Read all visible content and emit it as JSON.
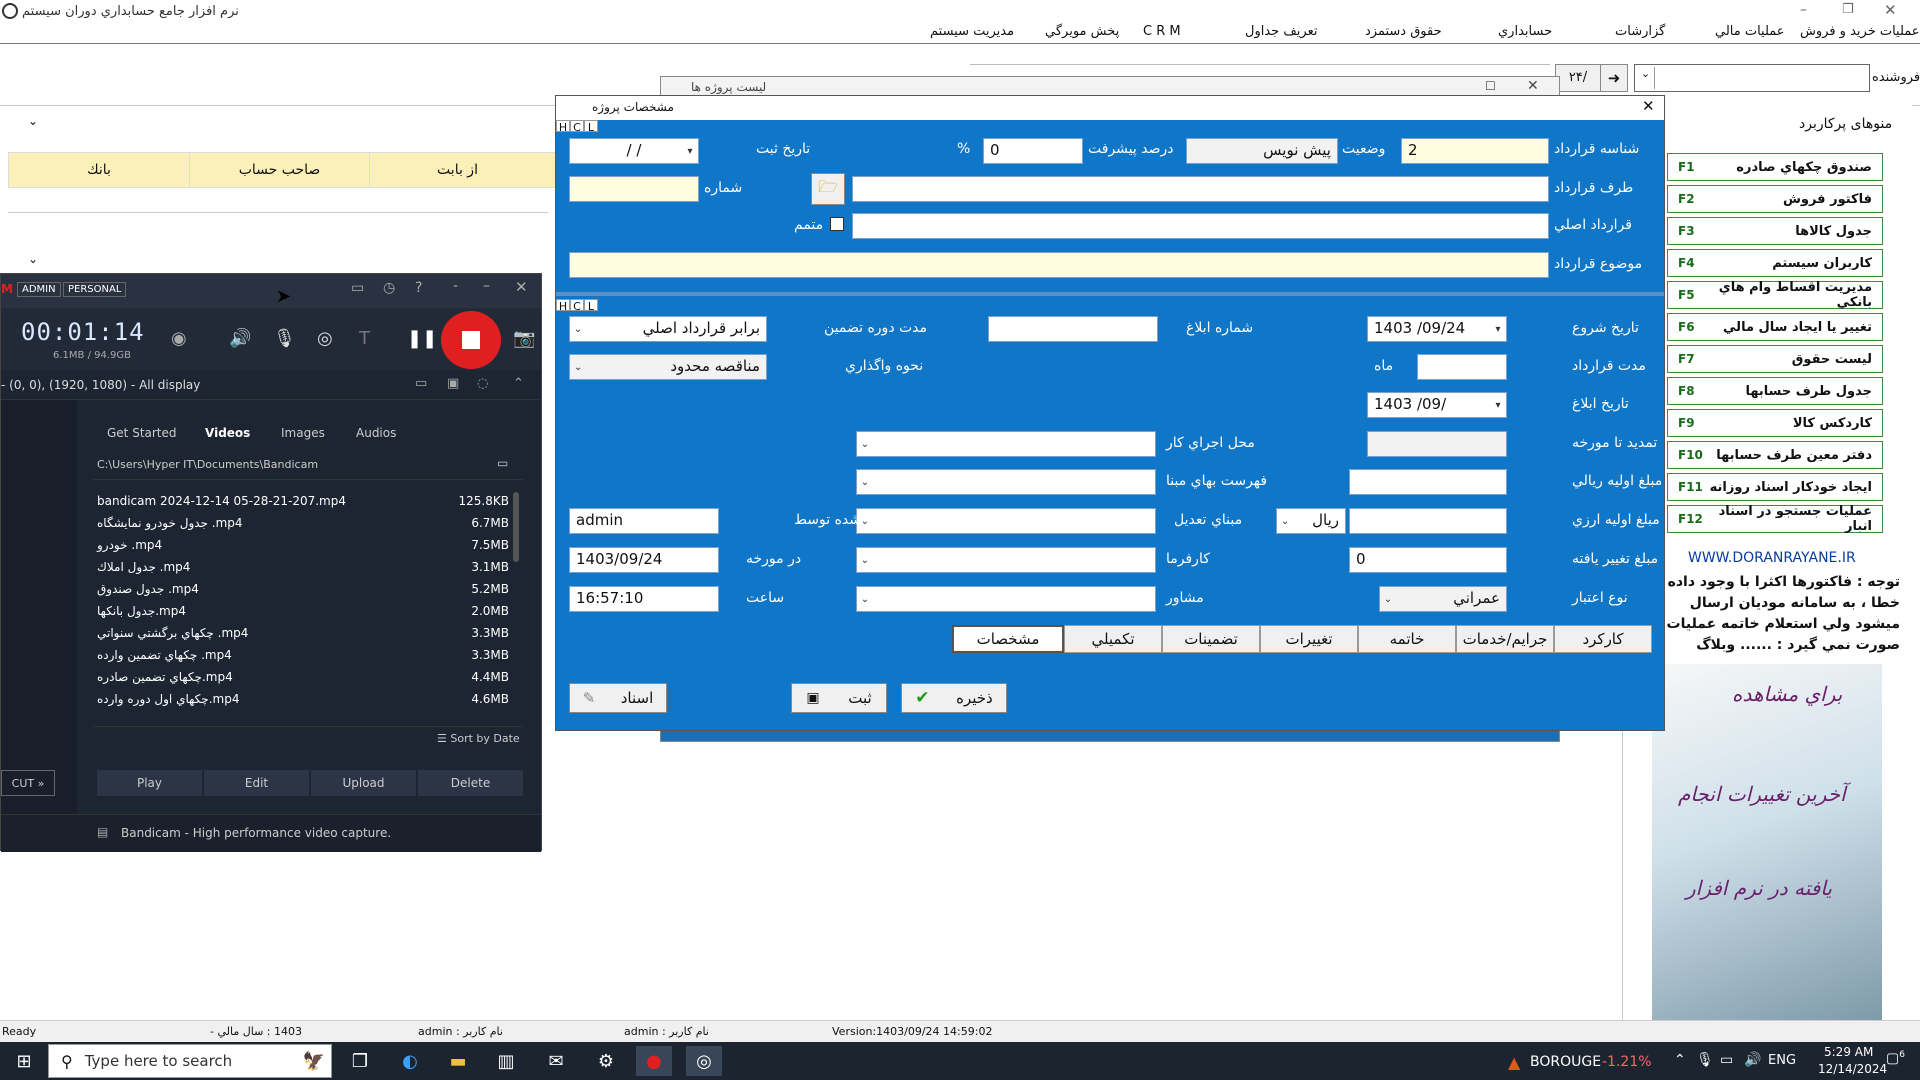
{
  "app": {
    "title": "نرم افزار جامع حسابداري دوران سيستم",
    "menu": [
      "عمليات خريد و فروش",
      "عمليات مالي",
      "گزارشات",
      "حسابداري",
      "حقوق دستمزد",
      "تعريف جداول",
      "C R M",
      "پخش مويرگي",
      "مديريت سيستم"
    ],
    "toolbar": {
      "num": "۲۴/",
      "seller_label": "فروشنده"
    },
    "bg_grid_headers": [
      "از بابت",
      "صاحب حساب",
      "بانك"
    ],
    "bg_window_title": "ليست پروژه ها",
    "status": {
      "ready": "Ready",
      "fiscal": "1403 : سال مالي -",
      "user1": "نام كاربر : admin",
      "user2": "نام كاربر : admin",
      "version": "Version:1403/09/24 14:59:02"
    }
  },
  "shortcuts": {
    "title": "منوهای پرکاربرد",
    "items": [
      {
        "label": "صندوق چكهاي صادره",
        "key": "F1"
      },
      {
        "label": "فاكتور فروش",
        "key": "F2"
      },
      {
        "label": "جدول كالاها",
        "key": "F3"
      },
      {
        "label": "كاربران سيستم",
        "key": "F4"
      },
      {
        "label": "مديريت اقساط وام هاي بانكي",
        "key": "F5"
      },
      {
        "label": "تغيير يا ايجاد سال مالي",
        "key": "F6"
      },
      {
        "label": "ليست حقوق",
        "key": "F7"
      },
      {
        "label": "جدول طرف حسابها",
        "key": "F8"
      },
      {
        "label": "كاردكس كالا",
        "key": "F9"
      },
      {
        "label": "دفتر معين طرف حسابها",
        "key": "F10"
      },
      {
        "label": "ايجاد خودكار اسناد روزانه",
        "key": "F11"
      },
      {
        "label": "عمليات جستجو در اسناد انبار",
        "key": "F12"
      }
    ],
    "website": "WWW.DORANRAYANE.IR",
    "notice": "توجه : فاكتورها اكثرا با وجود داده خطا ، به سامانه موديان ارسال ميشود ولي استعلام خاتمه عمليات صورت نمي گيرد : ......  وبلاگ دوران رايانه",
    "promo1": "براي مشاهده",
    "promo2": "آخرين تغييرات انجام",
    "promo3": "يافته در نرم افزار"
  },
  "dialog": {
    "title": "مشخصات پروژه",
    "hcl": [
      "H",
      "C",
      "L"
    ],
    "contract_id_label": "شناسه قرارداد",
    "contract_id_value": "2",
    "status_label": "وضعيت",
    "status_value": "پيش نويس",
    "progress_label": "درصد پيشرفت",
    "progress_value": "0",
    "percent_sign": "%",
    "reg_date_label": "تاريخ ثبت",
    "reg_date_value": "/  /",
    "counterparty_label": "طرف قرارداد",
    "number_label": "شماره",
    "original_contract_label": "قرارداد اصلي",
    "attached_label": "متمم",
    "subject_label": "موضوع قرارداد",
    "start_date_label": "تاريخ شروع",
    "start_date_value": "1403 /09/24",
    "notice_no_label": "شماره ابلاغ",
    "guarantee_label": "مدت دوره تضمين",
    "guarantee_value": "برابر قرارداد اصلي",
    "duration_label": "مدت قرارداد",
    "month_label": "ماه",
    "assign_label": "نحوه واگذاري",
    "assign_value": "مناقصه محدود",
    "notice_date_label": "تاريخ ابلاغ",
    "notice_date_value": "1403 /09/",
    "extend_label": "تمديد تا مورخه",
    "location_label": "محل اجراي كار",
    "initial_rial_label": "مبلغ اوليه ريالي",
    "price_list_label": "فهرست بهاي مبنا",
    "initial_fx_label": "مبلغ اوليه ارزي",
    "currency_value": "ريال",
    "adjust_label": "مبناي تعديل",
    "created_by_label": "ايجاد شده توسط",
    "created_by_value": "admin",
    "changed_amount_label": "مبلغ تغيير يافته",
    "changed_amount_value": "0",
    "employer_label": "كارفرما",
    "dated_label": "در مورخه",
    "dated_value": "1403/09/24",
    "credit_type_label": "نوع اعتبار",
    "credit_type_value": "عمراني",
    "consultant_label": "مشاور",
    "time_label": "ساعت",
    "time_value": "16:57:10",
    "tabs": [
      "كاركرد",
      "جرايم/خدمات",
      "خاتمه",
      "تغييرات",
      "تضمينات",
      "تكميلي",
      "مشخصات"
    ],
    "save_label": "ذخيره",
    "register_label": "ثبت",
    "docs_label": "اسناد"
  },
  "bandicam": {
    "badges": [
      "ADMIN",
      "PERSONAL"
    ],
    "timer": "00:01:14",
    "size": "6.1MB / 94.9GB",
    "display": "- (0, 0), (1920, 1080) - All display",
    "tabs": [
      "Get Started",
      "Videos",
      "Images",
      "Audios"
    ],
    "path": "C:\\Users\\Hyper IT\\Documents\\Bandicam",
    "files": [
      {
        "name": "bandicam 2024-12-14 05-28-21-207.mp4",
        "size": "125.8KB"
      },
      {
        "name": "جدول خودرو نمايشگاه .mp4",
        "size": "6.7MB"
      },
      {
        "name": "خودرو .mp4",
        "size": "7.5MB"
      },
      {
        "name": "جدول املاك .mp4",
        "size": "3.1MB"
      },
      {
        "name": "جدول صندوق .mp4",
        "size": "5.2MB"
      },
      {
        "name": "جدول بانكها.mp4",
        "size": "2.0MB"
      },
      {
        "name": "چكهاي برگشتي سنواتي .mp4",
        "size": "3.3MB"
      },
      {
        "name": "چكهاي تضمين وارده .mp4",
        "size": "3.3MB"
      },
      {
        "name": "چكهاي تضمين صادره.mp4",
        "size": "4.4MB"
      },
      {
        "name": "چكهاي اول دوره وارده.mp4",
        "size": "4.6MB"
      }
    ],
    "sort": "Sort by Date",
    "buttons": [
      "Play",
      "Edit",
      "Upload",
      "Delete"
    ],
    "cut": "CUT",
    "footer": "Bandicam - High performance video capture."
  },
  "taskbar": {
    "search_placeholder": "Type here to search",
    "stock_name": "BOROUGE",
    "stock_change": "-1.21%",
    "lang": "ENG",
    "time": "5:29 AM",
    "date": "12/14/2024",
    "notif_count": "6"
  },
  "colors": {
    "dialog_bg": "#0f76c8",
    "accent_red": "#e02020",
    "taskbar": "#1c2430",
    "bandicam_bg": "#1d2533"
  }
}
